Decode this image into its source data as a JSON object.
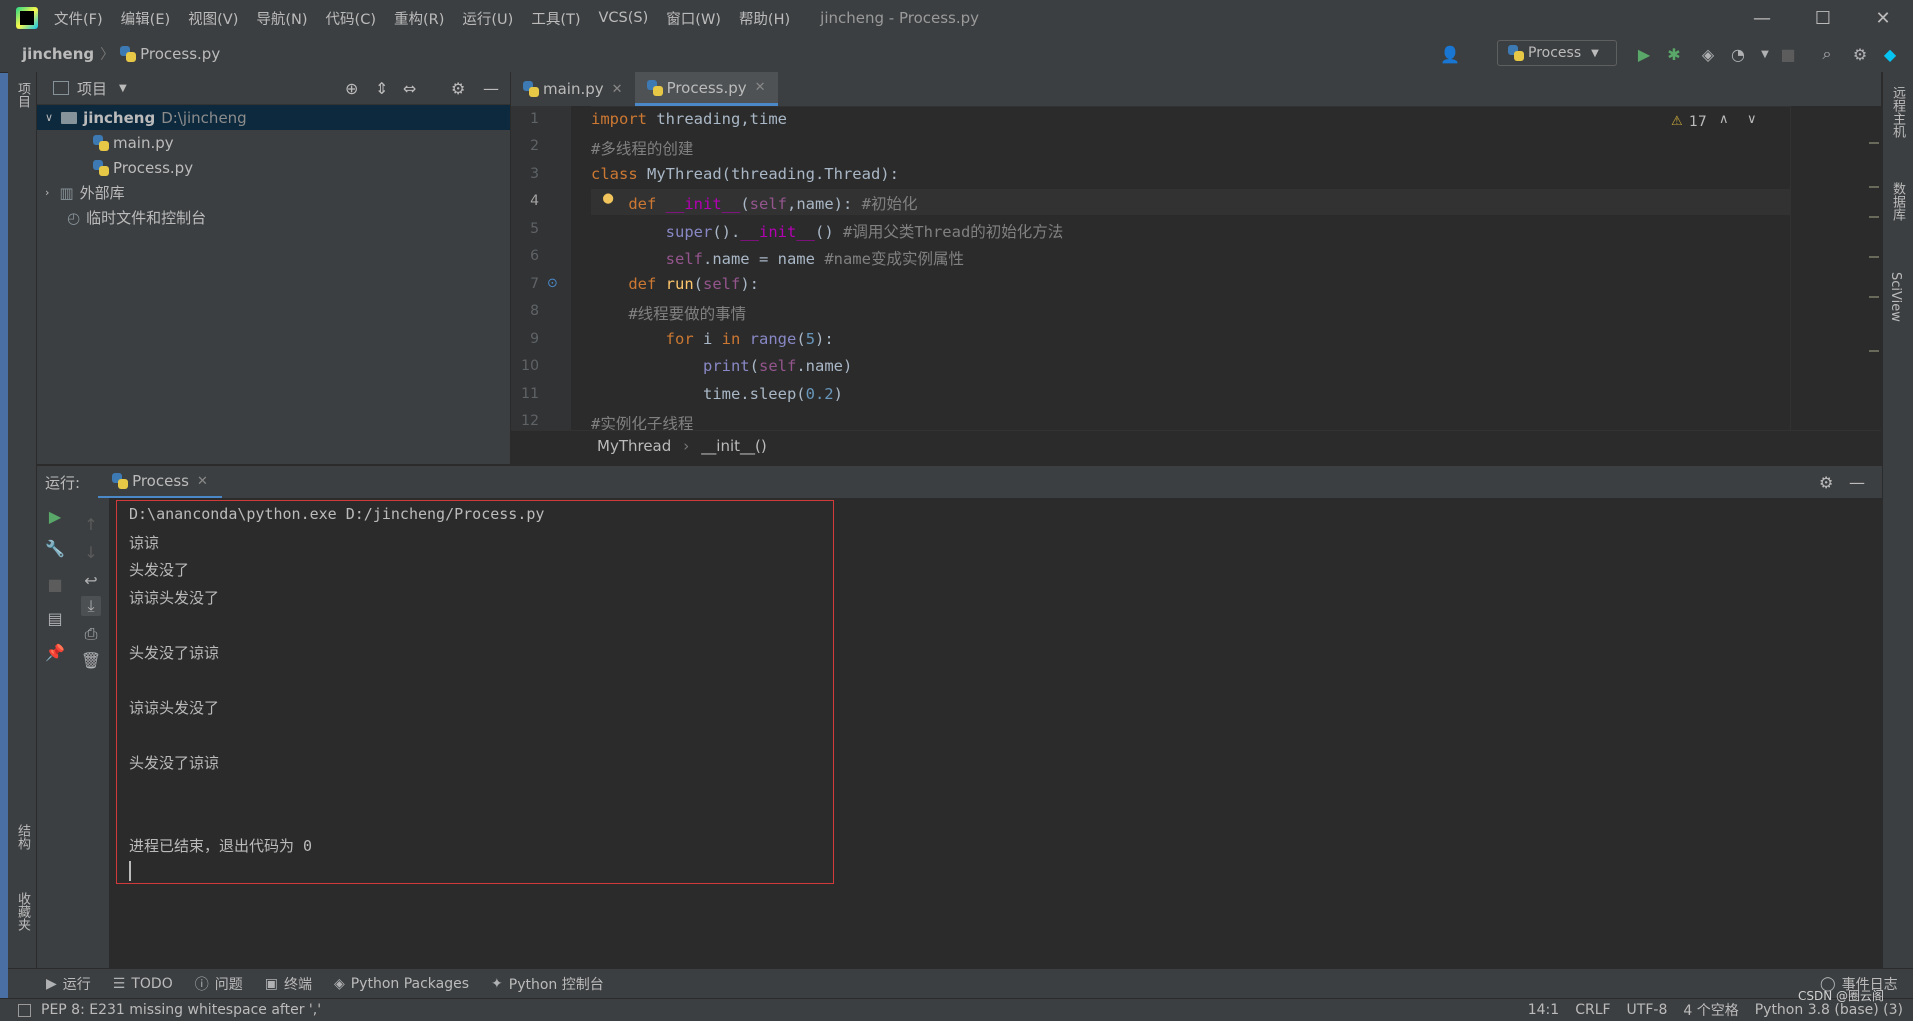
{
  "menubar": {
    "items": [
      "文件(F)",
      "编辑(E)",
      "视图(V)",
      "导航(N)",
      "代码(C)",
      "重构(R)",
      "运行(U)",
      "工具(T)",
      "VCS(S)",
      "窗口(W)",
      "帮助(H)"
    ],
    "window_title": "jincheng - Process.py"
  },
  "navbar": {
    "project": "jincheng",
    "file": "Process.py",
    "run_config": "Process"
  },
  "left_strip": {
    "project_label": "项目",
    "structure_label": "结构",
    "favorites_label": "收藏夹"
  },
  "right_strip": {
    "remote_label": "远程主机",
    "database_label": "数据库",
    "sciview_label": "SciView"
  },
  "project_panel": {
    "title": "项目",
    "root_name": "jincheng",
    "root_path": "D:\\jincheng",
    "files": [
      "main.py",
      "Process.py"
    ],
    "external_libs": "外部库",
    "scratches": "临时文件和控制台"
  },
  "editor": {
    "tabs": [
      "main.py",
      "Process.py"
    ],
    "warnings": "17",
    "line_numbers": [
      "1",
      "2",
      "3",
      "4",
      "5",
      "6",
      "7",
      "8",
      "9",
      "10",
      "11",
      "12"
    ],
    "breadcrumb": [
      "MyThread",
      "__init__()"
    ]
  },
  "run_panel": {
    "label": "运行:",
    "tab": "Process",
    "console": [
      "D:\\ananconda\\python.exe D:/jincheng/Process.py",
      "谅谅",
      "头发没了",
      "谅谅头发没了",
      "",
      "头发没了谅谅",
      "",
      "谅谅头发没了",
      "",
      "头发没了谅谅",
      "",
      "",
      "进程已结束，退出代码为 0"
    ]
  },
  "bottom_tools": [
    "运行",
    "TODO",
    "问题",
    "终端",
    "Python Packages",
    "Python 控制台"
  ],
  "event_log": "事件日志",
  "status": {
    "message": "PEP 8: E231 missing whitespace after ','",
    "position": "14:1",
    "line_sep": "CRLF",
    "encoding": "UTF-8",
    "indent": "4 个空格",
    "interpreter": "Python 3.8 (base) (3)",
    "watermark": "CSDN @圈云阁"
  }
}
